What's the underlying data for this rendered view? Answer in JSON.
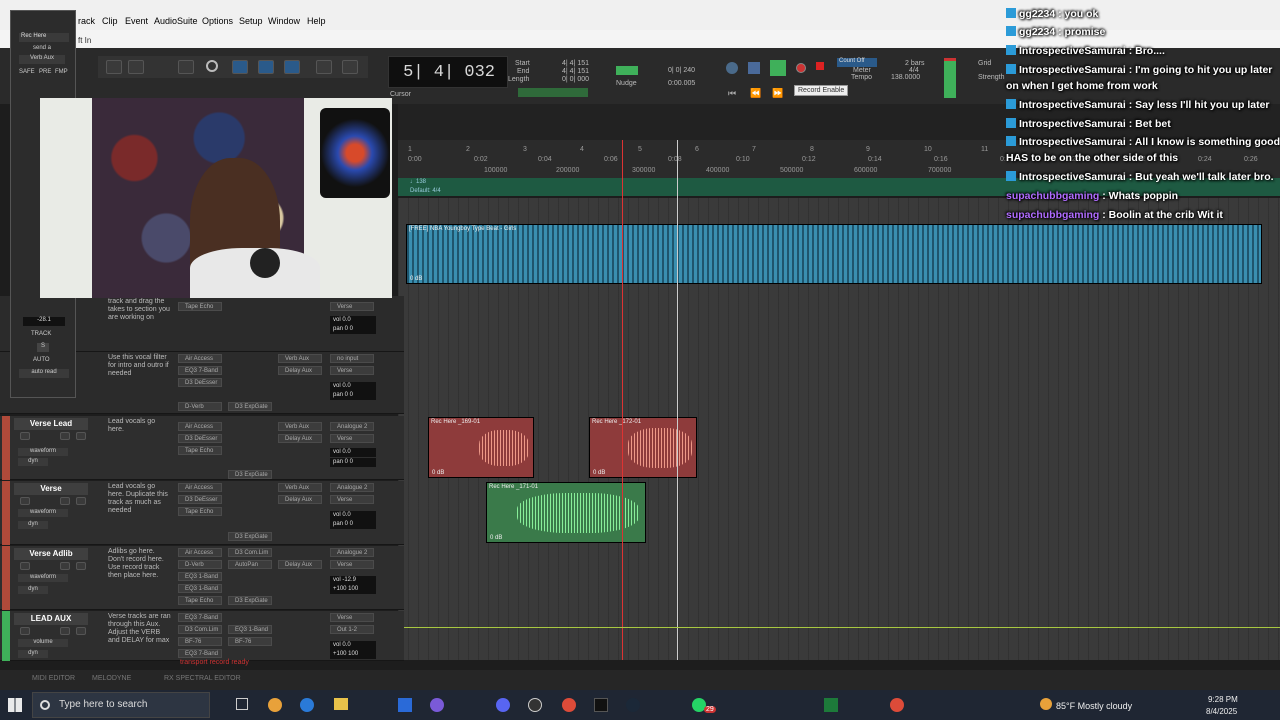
{
  "menu": {
    "items": [
      "rack",
      "Clip",
      "Event",
      "AudioSuite",
      "Options",
      "Setup",
      "Window",
      "Help"
    ]
  },
  "subbar": {
    "label": "ft In"
  },
  "transport": {
    "counter": "5| 4| 032",
    "start_label": "Start",
    "start": "4| 4| 151",
    "end_label": "End",
    "end": "4| 4| 151",
    "length_label": "Length",
    "length": "0| 0| 000",
    "cursor_label": "Cursor",
    "nudge_label": "Nudge",
    "nudge": "0:00.005",
    "grid_value": "0| 0| 240",
    "count_off": "Count Off",
    "meter_label": "Meter",
    "tempo_label": "Tempo",
    "bars": "2 bars",
    "meter": "4/4",
    "tempo": "138.0000",
    "tooltip": "Record Enable",
    "grid_label": "Grid",
    "strength_label": "Strength"
  },
  "ruler": {
    "bars": [
      "1",
      "2",
      "3",
      "4",
      "5",
      "6",
      "7",
      "8",
      "9",
      "10",
      "11"
    ],
    "times": [
      "0:00",
      "0:02",
      "0:04",
      "0:06",
      "0:08",
      "0:10",
      "0:12",
      "0:14",
      "0:16",
      "0:18",
      "0:20",
      "0:22",
      "0:24",
      "0:26"
    ],
    "samples": [
      "100000",
      "200000",
      "300000",
      "400000",
      "500000",
      "600000",
      "700000"
    ],
    "tempo_lane": "♩138",
    "meter_lane": "Default: 4/4"
  },
  "beat_clip": {
    "name": "[FREE] NBA Youngboy Type Beat - Girls",
    "db": "0 dB"
  },
  "upper_tracks": [
    {
      "comment": "track and drag the takes to section you are working on",
      "inserts": [
        "Tape Echo"
      ],
      "sends": [
        "Verse"
      ],
      "vol": "vol 0.0",
      "pan": "pan 0 0"
    },
    {
      "comment": "Use this vocal filter for intro and outro if needed",
      "inserts": [
        "Air Access",
        "EQ3 7-Band",
        "D3 DeEsser",
        "D-Verb"
      ],
      "inserts2": [
        "Verb Aux",
        "Delay Aux",
        "D3 ExpGate"
      ],
      "sends": [
        "no input",
        "Verse"
      ],
      "vol": "vol 0.0",
      "pan": "pan 0 0"
    }
  ],
  "tracks": [
    {
      "name": "Verse Lead",
      "comment": "Lead vocals go here.",
      "inserts": [
        "Air Access",
        "D3 DeEsser",
        "Tape Echo"
      ],
      "inserts2": [
        "Verb Aux",
        "Delay Aux",
        "D3 ExpGate"
      ],
      "sends": [
        "Analogue 2",
        "Verse"
      ],
      "view": "waveform",
      "dyn": "dyn",
      "vol": "vol 0.0",
      "pan": "pan 0 0"
    },
    {
      "name": "Verse",
      "comment": "Lead vocals go here. Duplicate this track as much as needed",
      "inserts": [
        "Air Access",
        "D3 DeEsser",
        "Tape Echo"
      ],
      "inserts2": [
        "Verb Aux",
        "Delay Aux",
        "D3 ExpGate"
      ],
      "sends": [
        "Analogue 2",
        "Verse"
      ],
      "view": "waveform",
      "dyn": "dyn",
      "vol": "vol 0.0",
      "pan": "pan 0 0"
    },
    {
      "name": "Verse Adlib",
      "comment": "Adlibs go here. Don't record here. Use record track then place here.",
      "inserts": [
        "Air Access",
        "D-Verb",
        "EQ3 1-Band",
        "EQ3 1-Band",
        "Tape Echo"
      ],
      "inserts2": [
        "D3 Com.Lim",
        "AutoPan",
        "Delay Aux",
        "D3 ExpGate"
      ],
      "sends": [
        "Analogue 2",
        "Verse"
      ],
      "view": "waveform",
      "dyn": "dyn",
      "vol": "vol -12.9",
      "pan": "+100 100"
    },
    {
      "name": "LEAD AUX",
      "comment": "Verse tracks are ran through this Aux. Adjust the VERB and DELAY for max",
      "inserts": [
        "EQ3 7-Band",
        "D3 Com.Lim",
        "BF-76",
        "EQ3 7-Band"
      ],
      "inserts2": [
        "EQ3 1-Band",
        "BF-76"
      ],
      "sends": [
        "Verse",
        "Out 1-2"
      ],
      "view": "volume",
      "dyn": "dyn",
      "vol": "vol 0.0",
      "pan": "+100 100"
    }
  ],
  "clips": [
    {
      "name": "Rec Here _169-01",
      "db": "0 dB"
    },
    {
      "name": "Rec Here _172-01",
      "db": "0 dB"
    },
    {
      "name": "Rec Here _171-01",
      "db": "0 dB"
    }
  ],
  "status": "transport record ready",
  "mixer": {
    "name": "Rec Here",
    "send": "send a",
    "aux": "Verb Aux",
    "safe": "SAFE",
    "pre": "PRE",
    "fmp": "FMP",
    "level": "-28.1",
    "track": "TRACK",
    "s": "S",
    "auto": "AUTO",
    "auto_mode": "auto read"
  },
  "bottom": {
    "midi": "MIDI EDITOR",
    "melodyne": "MELODYNE",
    "rx": "RX SPECTRAL EDITOR"
  },
  "chat": [
    {
      "user": "gg2234",
      "msg": " : you ok",
      "color": "u1"
    },
    {
      "user": "gg2234",
      "msg": " : promise",
      "color": "u1"
    },
    {
      "user": "IntrospectiveSamurai",
      "msg": " : Bro....",
      "color": "u1"
    },
    {
      "user": "IntrospectiveSamurai",
      "msg": " : I'm going to hit you up later on when I get home from work",
      "color": "u1"
    },
    {
      "user": "IntrospectiveSamurai",
      "msg": " : Say less I'll hit you up later",
      "color": "u1"
    },
    {
      "user": "IntrospectiveSamurai",
      "msg": " : Bet bet",
      "color": "u1"
    },
    {
      "user": "IntrospectiveSamurai",
      "msg": " : All I know is something good HAS to be on the other side of this",
      "color": "u1"
    },
    {
      "user": "IntrospectiveSamurai",
      "msg": " : But yeah we'll talk later bro.",
      "color": "u1"
    },
    {
      "user": "supachubbgaming",
      "msg": " : Whats poppin",
      "color": "u2"
    },
    {
      "user": "supachubbgaming",
      "msg": " : Boolin at the crib Wit it",
      "color": "u2"
    }
  ],
  "taskbar": {
    "search": "Type here to search",
    "weather": "85°F  Mostly cloudy",
    "time": "9:28 PM",
    "date": "8/4/2025",
    "badge": "29"
  },
  "colors": {
    "accent_green": "#3fb05a",
    "clip_red": "#8e3b3b",
    "clip_green": "#3a7a4a",
    "clip_blue": "#3a8fb0"
  }
}
